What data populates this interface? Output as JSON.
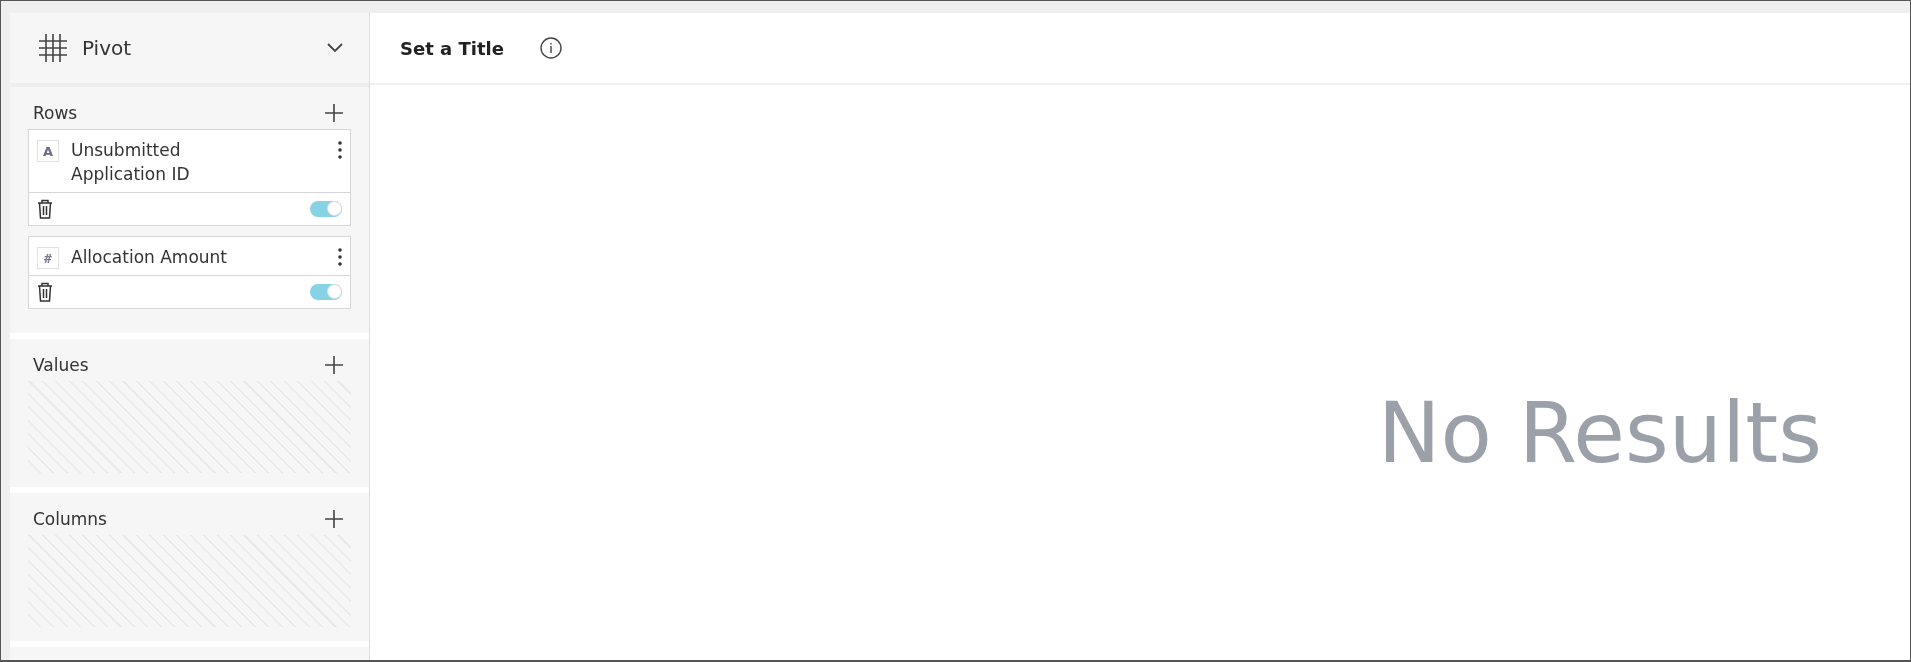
{
  "sidebar": {
    "view_label": "Pivot",
    "sections": [
      {
        "title": "Rows",
        "fields": [
          {
            "kind": "text",
            "type_glyph": "A",
            "label": "Unsubmitted Application ID",
            "on": true
          },
          {
            "kind": "number",
            "type_glyph": "#",
            "label": "Allocation Amount",
            "on": true
          }
        ]
      },
      {
        "title": "Values"
      },
      {
        "title": "Columns"
      }
    ]
  },
  "main": {
    "title": "Set a Title",
    "message": "No Results"
  }
}
